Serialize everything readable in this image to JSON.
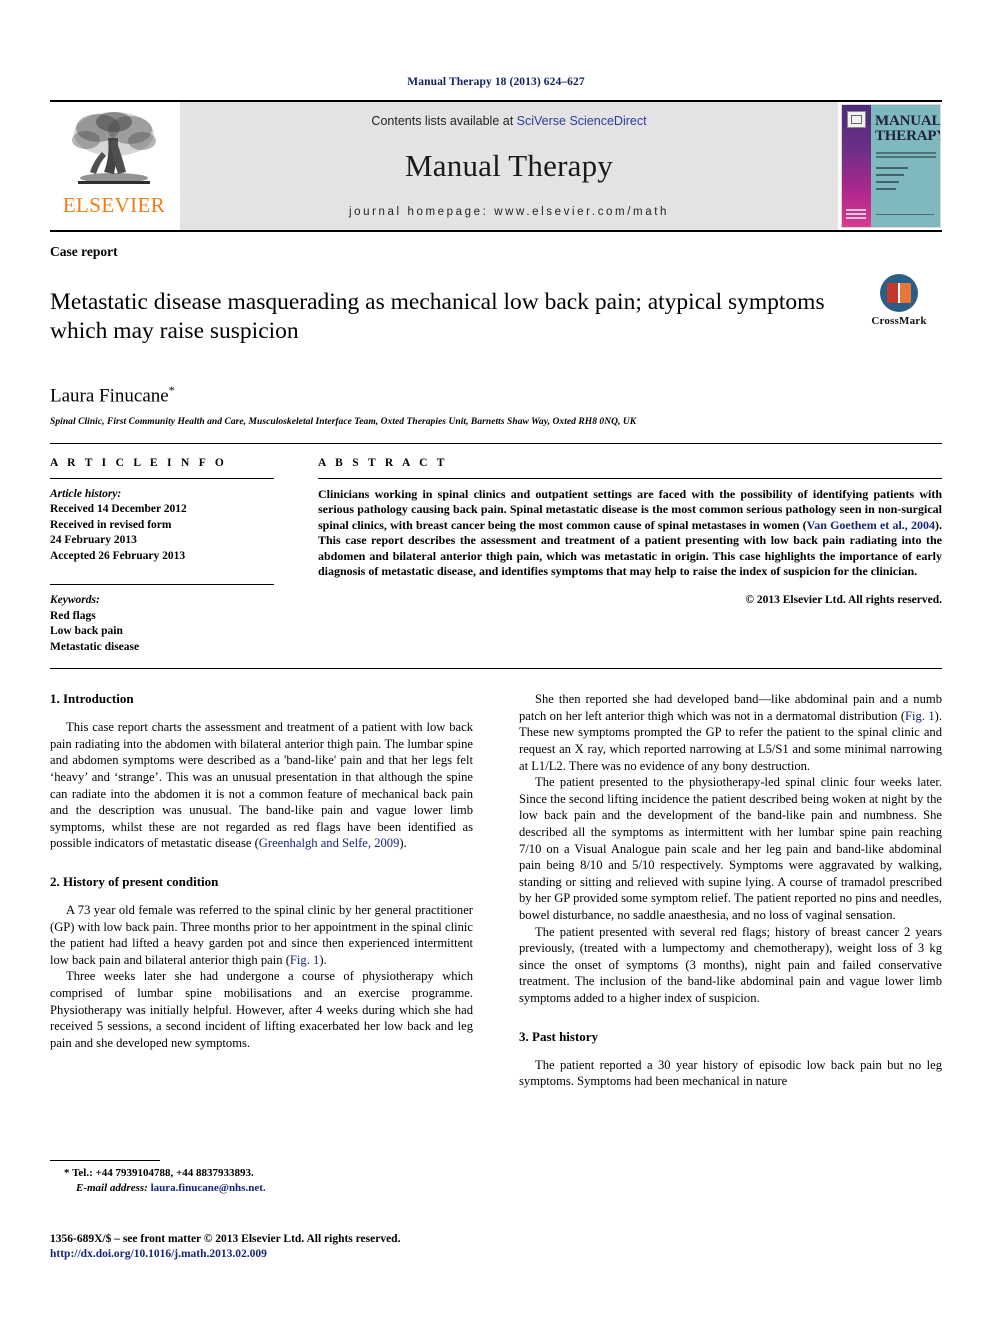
{
  "running_head": "Manual Therapy 18 (2013) 624–627",
  "masthead": {
    "publisher_name": "ELSEVIER",
    "contents_prefix": "Contents lists available at ",
    "contents_link": "SciVerse ScienceDirect",
    "journal_title": "Manual Therapy",
    "homepage": "journal homepage: www.elsevier.com/math",
    "cover": {
      "title_line1": "MANUAL",
      "title_line2": "THERAPY"
    }
  },
  "article": {
    "type": "Case report",
    "title": "Metastatic disease masquerading as mechanical low back pain; atypical symptoms which may raise suspicion",
    "crossmark_label": "CrossMark",
    "author": "Laura Finucane",
    "author_marker": "*",
    "affiliation": "Spinal Clinic, First Community Health and Care, Musculoskeletal Interface Team, Oxted Therapies Unit, Barnetts Shaw Way, Oxted RH8 0NQ, UK"
  },
  "article_info": {
    "heading": "A R T I C L E  I N F O",
    "history_label": "Article history:",
    "history": [
      "Received 14 December 2012",
      "Received in revised form",
      "24 February 2013",
      "Accepted 26 February 2013"
    ],
    "keywords_label": "Keywords:",
    "keywords": [
      "Red flags",
      "Low back pain",
      "Metastatic disease"
    ]
  },
  "abstract": {
    "heading": "A B S T R A C T",
    "part1": "Clinicians working in spinal clinics and outpatient settings are faced with the possibility of identifying patients with serious pathology causing back pain. Spinal metastatic disease is the most common serious pathology seen in non-surgical spinal clinics, with breast cancer being the most common cause of spinal metastases in women (",
    "citation": "Van Goethem et al., 2004",
    "part2": "). This case report describes the assessment and treatment of a patient presenting with low back pain radiating into the abdomen and bilateral anterior thigh pain, which was metastatic in origin. This case highlights the importance of early diagnosis of metastatic disease, and identifies symptoms that may help to raise the index of suspicion for the clinician.",
    "copyright": "© 2013 Elsevier Ltd. All rights reserved."
  },
  "sections": {
    "introduction": {
      "number_title": "1. Introduction",
      "p1_a": "This case report charts the assessment and treatment of a patient with low back pain radiating into the abdomen with bilateral anterior thigh pain. The lumbar spine and abdomen symptoms were described as a 'band-like' pain and that her legs felt ‘heavy’ and ‘strange’. This was an unusual presentation in that although the spine can radiate into the abdomen it is not a common feature of mechanical back pain and the description was unusual. The band-like pain and vague lower limb symptoms, whilst these are not regarded as red flags have been identified as possible indicators of metastatic disease (",
      "p1_ref": "Greenhalgh and Selfe, 2009",
      "p1_b": ")."
    },
    "history_present": {
      "number_title": "2. History of present condition",
      "p1_a": "A 73 year old female was referred to the spinal clinic by her general practitioner (GP) with low back pain. Three months prior to her appointment in the spinal clinic the patient had lifted a heavy garden pot and since then experienced intermittent low back pain and bilateral anterior thigh pain (",
      "p1_ref": "Fig. 1",
      "p1_b": ").",
      "p2": "Three weeks later she had undergone a course of physiotherapy which comprised of lumbar spine mobilisations and an exercise programme. Physiotherapy was initially helpful. However, after 4 weeks during which she had received 5 sessions, a second incident of lifting exacerbated her low back and leg pain and she developed new symptoms.",
      "p3_a": "She then reported she had developed band—like abdominal pain and a numb patch on her left anterior thigh which was not in a dermatomal distribution (",
      "p3_ref": "Fig. 1",
      "p3_b": "). These new symptoms prompted the GP to refer the patient to the spinal clinic and request an X ray, which reported narrowing at L5/S1 and some minimal narrowing at L1/L2. There was no evidence of any bony destruction.",
      "p4": "The patient presented to the physiotherapy-led spinal clinic four weeks later. Since the second lifting incidence the patient described being woken at night by the low back pain and the development of the band-like pain and numbness. She described all the symptoms as intermittent with her lumbar spine pain reaching 7/10 on a Visual Analogue pain scale and her leg pain and band-like abdominal pain being 8/10 and 5/10 respectively. Symptoms were aggravated by walking, standing or sitting and relieved with supine lying. A course of tramadol prescribed by her GP provided some symptom relief. The patient reported no pins and needles, bowel disturbance, no saddle anaesthesia, and no loss of vaginal sensation.",
      "p5": "The patient presented with several red flags; history of breast cancer 2 years previously, (treated with a lumpectomy and chemotherapy), weight loss of 3 kg since the onset of symptoms (3 months), night pain and failed conservative treatment. The inclusion of the band-like abdominal pain and vague lower limb symptoms added to a higher index of suspicion."
    },
    "past_history": {
      "number_title": "3. Past history",
      "p1": "The patient reported a 30 year history of episodic low back pain but no leg symptoms. Symptoms had been mechanical in nature"
    }
  },
  "footnote": {
    "marker": "*",
    "tel": "Tel.: +44 7939104788, +44 8837933893.",
    "email_label": "E-mail address:",
    "email": "laura.finucane@nhs.net."
  },
  "footer": {
    "issn_line": "1356-689X/$ – see front matter © 2013 Elsevier Ltd. All rights reserved.",
    "doi": "http://dx.doi.org/10.1016/j.math.2013.02.009"
  }
}
